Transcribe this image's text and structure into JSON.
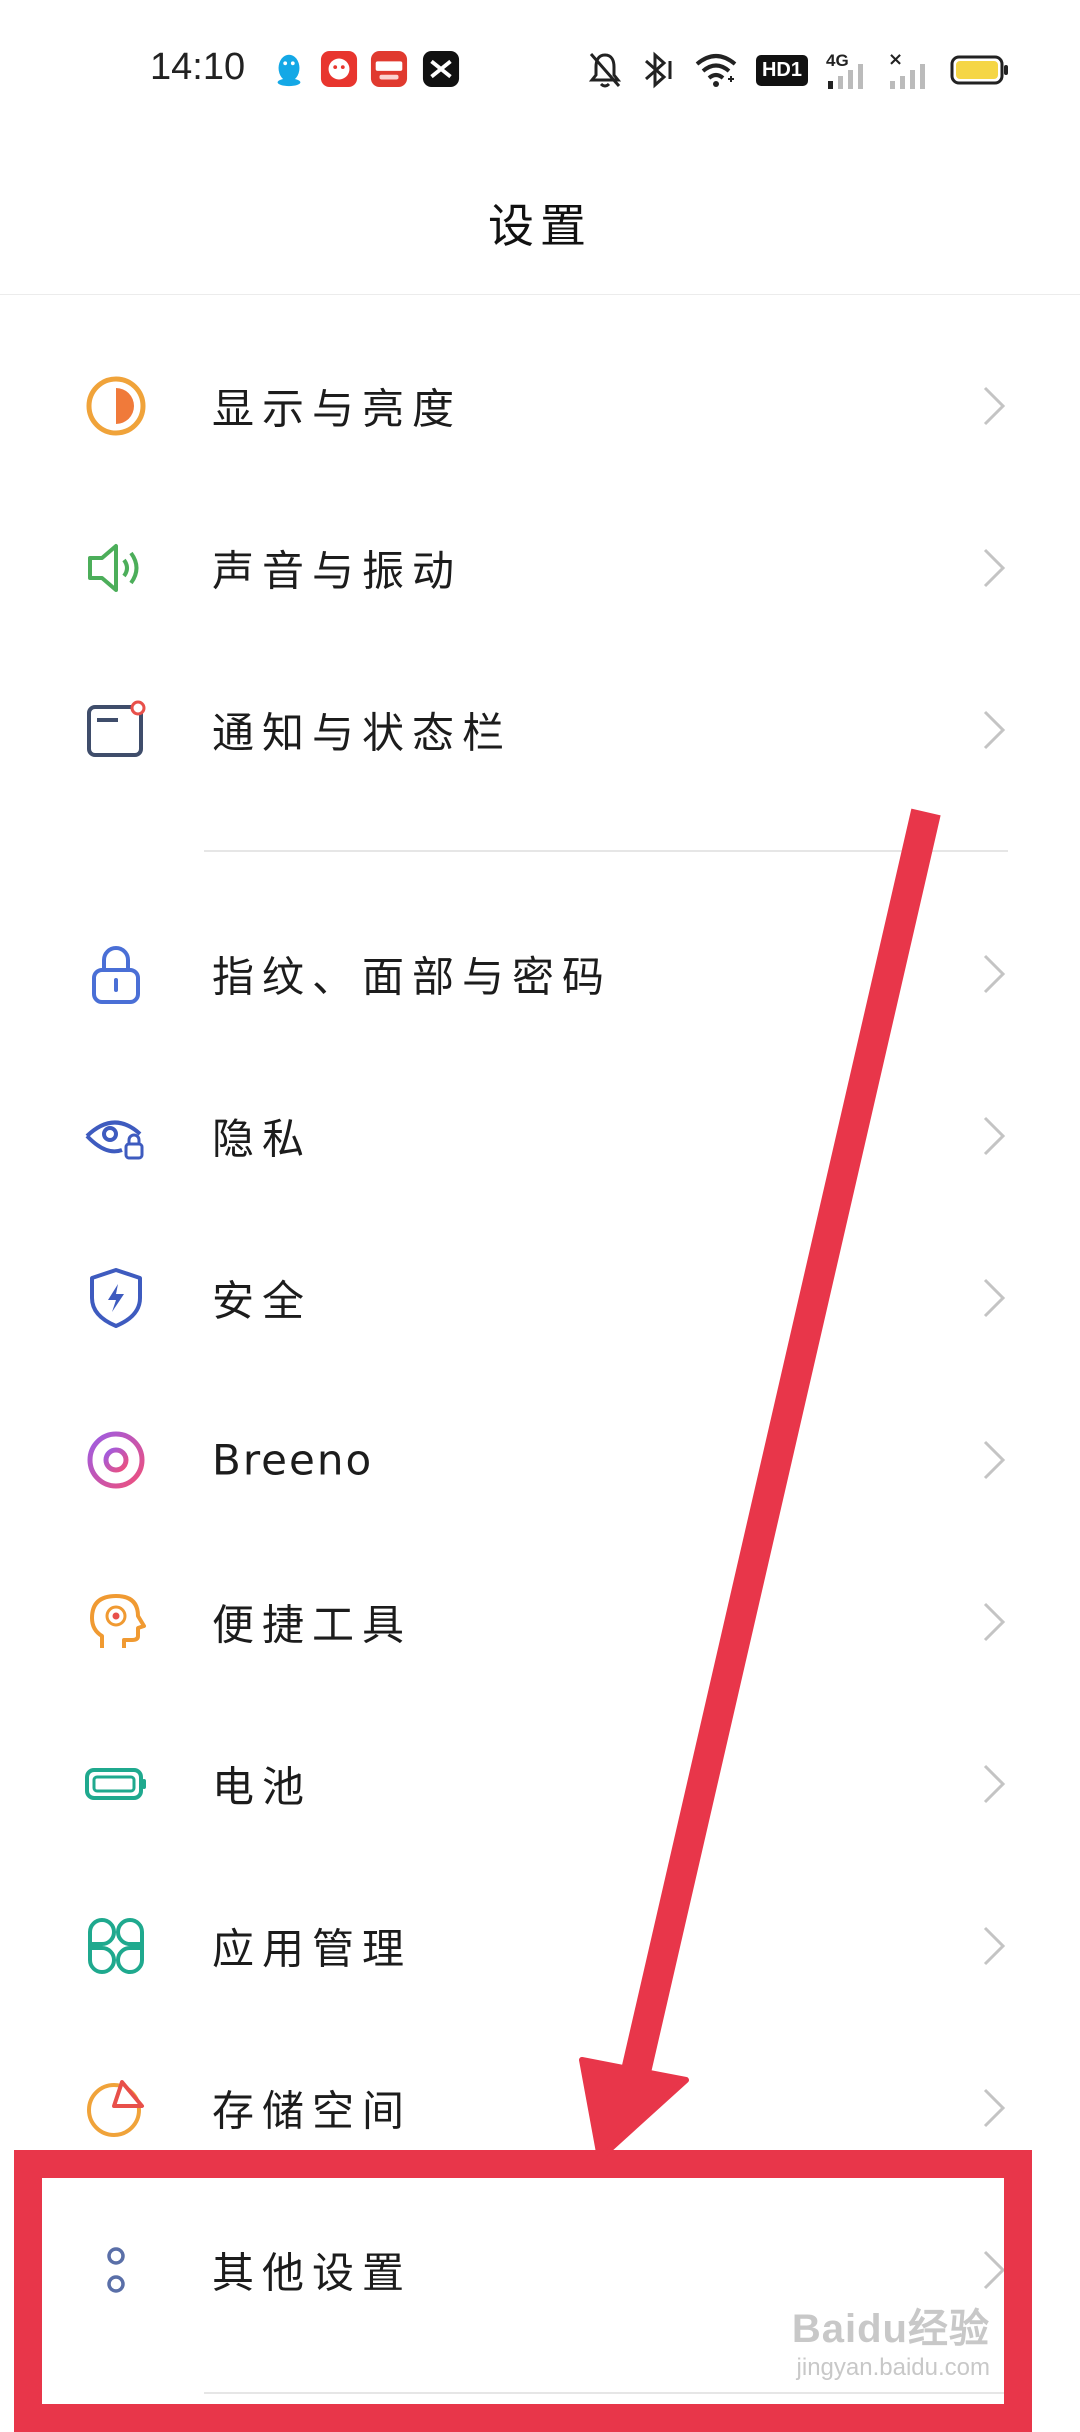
{
  "status_bar": {
    "time": "14:10",
    "icons_left": [
      "qq-icon",
      "app-red-icon",
      "app-red-2-icon",
      "capcut-icon"
    ],
    "icons_right": [
      "mute-bell-icon",
      "bluetooth-icon",
      "wifi-icon",
      "hd-icon",
      "signal-4g-icon",
      "signal-x-icon",
      "battery-icon"
    ],
    "hd_label": "HD1",
    "network_label": "4G"
  },
  "header": {
    "title": "设置"
  },
  "settings": {
    "items": [
      {
        "label": "显示与亮度",
        "icon": "display-brightness-icon",
        "color": "#f0a33a"
      },
      {
        "label": "声音与振动",
        "icon": "speaker-icon",
        "color": "#4cae5a"
      },
      {
        "label": "通知与状态栏",
        "icon": "notification-icon",
        "color": "#3f4d6b"
      },
      {
        "label": "指纹、面部与密码",
        "icon": "lock-icon",
        "color": "#4a6fd6"
      },
      {
        "label": "隐私",
        "icon": "privacy-eye-icon",
        "color": "#3e5bbf"
      },
      {
        "label": "安全",
        "icon": "shield-icon",
        "color": "#3e5bbf"
      },
      {
        "label": "Breeno",
        "icon": "breeno-icon",
        "color": "#b45ad9"
      },
      {
        "label": "便捷工具",
        "icon": "head-tools-icon",
        "color": "#f09a32"
      },
      {
        "label": "电池",
        "icon": "battery-setting-icon",
        "color": "#1fa98e"
      },
      {
        "label": "应用管理",
        "icon": "apps-grid-icon",
        "color": "#1fa98e"
      },
      {
        "label": "存储空间",
        "icon": "storage-pie-icon",
        "color": "#f0a33a"
      },
      {
        "label": "其他设置",
        "icon": "more-dots-icon",
        "color": "#5a6fa8"
      }
    ]
  },
  "annotation": {
    "color": "#e8364a"
  },
  "watermark": {
    "logo": "Baidu经验",
    "url": "jingyan.baidu.com"
  }
}
